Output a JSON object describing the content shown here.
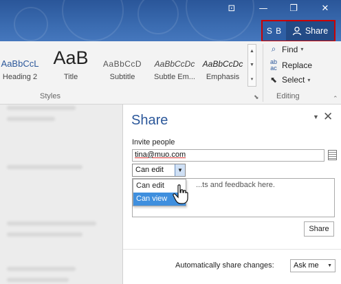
{
  "titlebar": {
    "user_initials": "S B",
    "share_label": "Share"
  },
  "styles_group": {
    "items": [
      {
        "sample": "AaBbCcL",
        "name": "Heading 2"
      },
      {
        "sample": "AaB",
        "name": "Title"
      },
      {
        "sample": "AaBbCcD",
        "name": "Subtitle"
      },
      {
        "sample": "AaBbCcDc",
        "name": "Subtle Em..."
      },
      {
        "sample": "AaBbCcDc",
        "name": "Emphasis"
      }
    ],
    "label": "Styles"
  },
  "editing_group": {
    "find": "Find",
    "replace": "Replace",
    "select": "Select",
    "label": "Editing"
  },
  "share_pane": {
    "title": "Share",
    "invite_label": "Invite people",
    "invite_value": "tina@muo.com",
    "permission": "Can edit",
    "permission_options": [
      "Can edit",
      "Can view"
    ],
    "message_placeholder": "...ts and feedback here.",
    "share_button": "Share",
    "auto_share_label": "Automatically share changes:",
    "auto_share_value": "Ask me"
  },
  "colors": {
    "accent": "#2b579a",
    "highlight_border": "#cc0000",
    "selected_option": "#3f8fde"
  }
}
